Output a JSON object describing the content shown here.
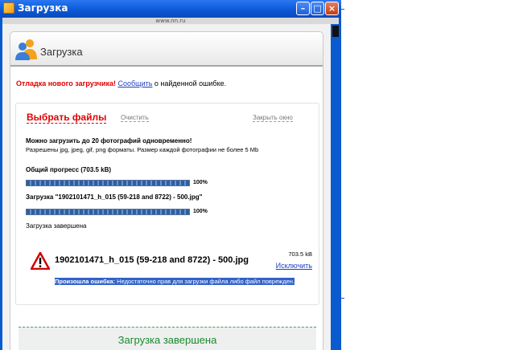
{
  "window": {
    "title": "Загрузка",
    "url": "www.nn.ru"
  },
  "header": {
    "title": "Загрузка"
  },
  "notice": {
    "prefix": "Отладка нового загрузчика!",
    "link": "Сообщить",
    "suffix": " о найденной ошибке."
  },
  "tabs": {
    "select_files": "Выбрать файлы",
    "clear": "Очистить",
    "close_window": "Закрыть окно"
  },
  "info": {
    "limit": "Можно загрузить до 20 фотографий одновременно!",
    "formats": "Разрешены jpg, jpeg, gif, png форматы. Размер каждой фотографии не более 5 Mb"
  },
  "progress": {
    "total_label": "Общий прогресс (703.5 kB)",
    "total_percent": "100%",
    "total_value": 1.0,
    "file_label": "Загрузка \"1902101471_h_015 (59-218 and 8722) - 500.jpg\"",
    "file_percent": "100%",
    "file_value": 1.0,
    "status": "Загрузка завершена"
  },
  "file": {
    "name": "1902101471_h_015 (59-218 and 8722) - 500.jpg",
    "size": "703.5 kB",
    "exclude": "Исключить",
    "error_label": "Произошла ошибка:",
    "error_text": " Недостаточно прав для загрузки файла либо файл поврежден."
  },
  "footer": {
    "done": "Загрузка завершена"
  },
  "colors": {
    "accent_red": "#e00000",
    "link_blue": "#1f3fc0",
    "success_green": "#188a2a",
    "title_blue": "#0a57d6"
  }
}
